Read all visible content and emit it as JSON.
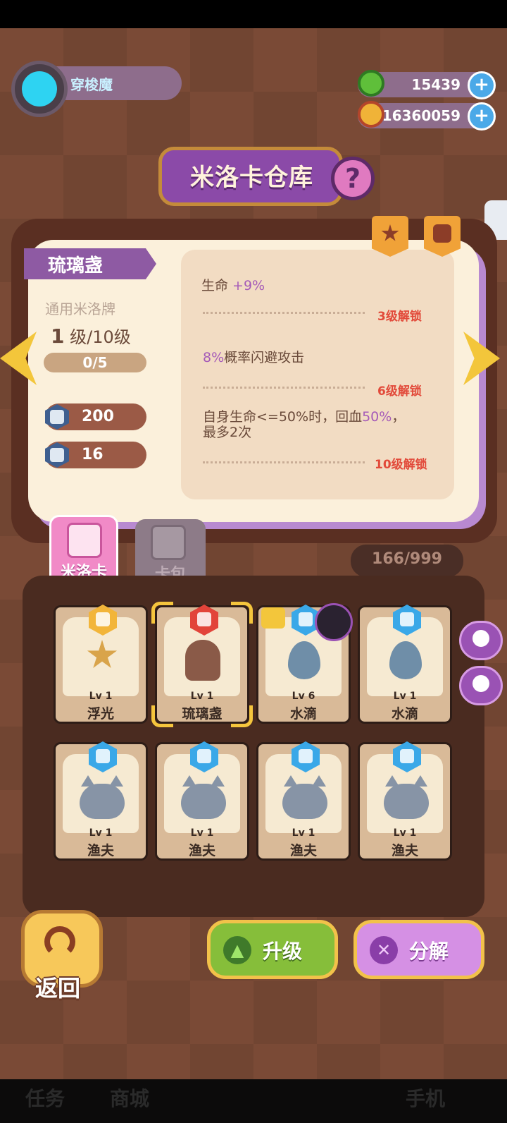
{
  "player": {
    "name": "穿梭魔"
  },
  "currencies": [
    {
      "icon": "donut-coin-icon",
      "value": "15439",
      "color": "#5fbf3a"
    },
    {
      "icon": "planet-coin-icon",
      "value": "16360059",
      "color": "#f0b338"
    }
  ],
  "title": "米洛卡仓库",
  "help_symbol": "?",
  "card": {
    "name": "琉璃盏",
    "type": "通用米洛牌",
    "level_current": "1",
    "level_text": "级/10级",
    "progress": "0/5",
    "stats": [
      {
        "icon": "hp-shield-icon",
        "value": "200"
      },
      {
        "icon": "defense-shield-icon",
        "value": "16"
      }
    ],
    "effects": [
      {
        "pre": "生命 ",
        "pct": "+9%",
        "post": "",
        "unlock": "3级解锁"
      },
      {
        "pre": "",
        "pct": "8%",
        "post": "概率闪避攻击",
        "unlock": "6级解锁"
      },
      {
        "pre": "自身生命<=50%时，回血",
        "pct": "50%",
        "post": "，最多2次",
        "unlock": "10级解锁"
      }
    ]
  },
  "tabs": {
    "milo": "米洛卡",
    "pack": "卡包"
  },
  "inventory_count": "166/999",
  "inventory": [
    {
      "lv": "Lv 1",
      "name": "浮光",
      "rarity_color": "#f2b53a",
      "art": "star"
    },
    {
      "lv": "Lv 1",
      "name": "琉璃盏",
      "rarity_color": "#e2443a",
      "art": "cup",
      "selected": true
    },
    {
      "lv": "Lv 6",
      "name": "水滴",
      "rarity_color": "#3aa8e8",
      "art": "drop",
      "locked": true
    },
    {
      "lv": "Lv 1",
      "name": "水滴",
      "rarity_color": "#3aa8e8",
      "art": "drop"
    },
    {
      "lv": "Lv 1",
      "name": "渔夫",
      "rarity_color": "#3aa8e8",
      "art": "cat"
    },
    {
      "lv": "Lv 1",
      "name": "渔夫",
      "rarity_color": "#3aa8e8",
      "art": "cat"
    },
    {
      "lv": "Lv 1",
      "name": "渔夫",
      "rarity_color": "#3aa8e8",
      "art": "cat"
    },
    {
      "lv": "Lv 1",
      "name": "渔夫",
      "rarity_color": "#3aa8e8",
      "art": "cat"
    }
  ],
  "buttons": {
    "back": "返回",
    "upgrade": "升级",
    "decompose": "分解"
  },
  "bottom_nav": [
    "任务",
    "商城",
    "手机"
  ]
}
